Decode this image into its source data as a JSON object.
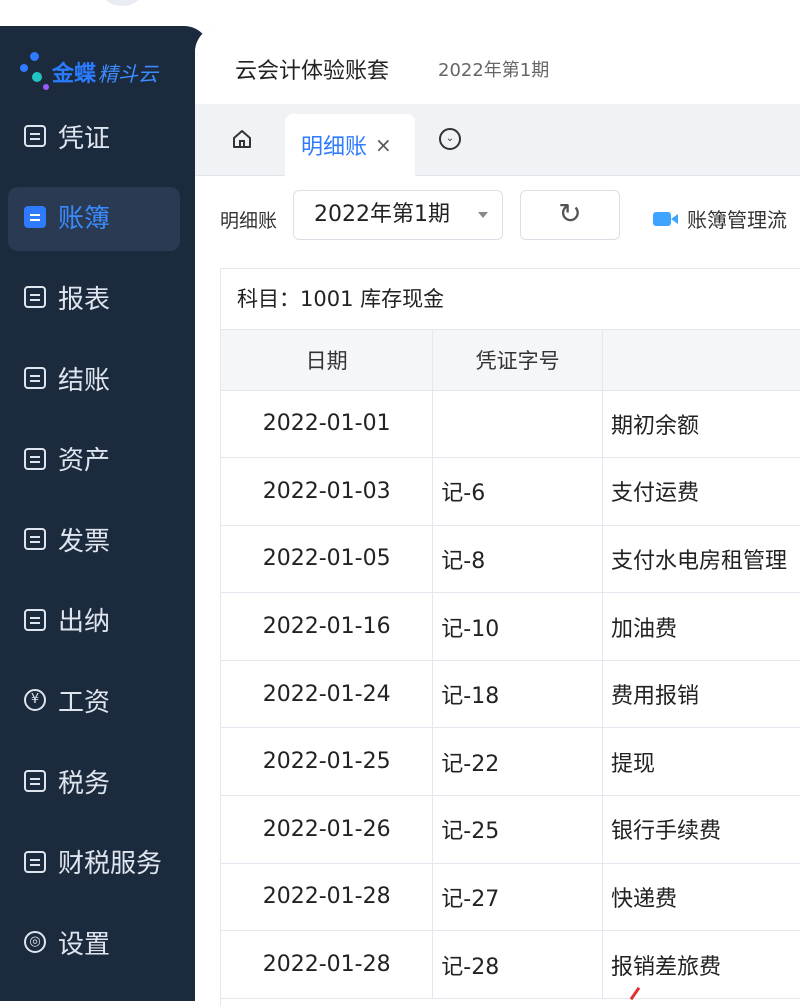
{
  "brand": {
    "name": "金蝶",
    "product": "精斗云"
  },
  "nav": {
    "items": [
      {
        "label": "凭证",
        "icon": "voucher-icon",
        "active": false
      },
      {
        "label": "账簿",
        "icon": "ledger-icon",
        "active": true
      },
      {
        "label": "报表",
        "icon": "report-icon",
        "active": false
      },
      {
        "label": "结账",
        "icon": "closing-icon",
        "active": false
      },
      {
        "label": "资产",
        "icon": "asset-icon",
        "active": false
      },
      {
        "label": "发票",
        "icon": "invoice-icon",
        "active": false
      },
      {
        "label": "出纳",
        "icon": "cashier-icon",
        "active": false
      },
      {
        "label": "工资",
        "icon": "salary-icon",
        "active": false
      },
      {
        "label": "税务",
        "icon": "tax-icon",
        "active": false
      },
      {
        "label": "财税服务",
        "icon": "service-icon",
        "active": false
      },
      {
        "label": "设置",
        "icon": "settings-icon",
        "active": false
      }
    ]
  },
  "header": {
    "title": "云会计体验账套",
    "period": "2022年第1期"
  },
  "tabs": {
    "items": [
      {
        "label": "明细账",
        "close": "×"
      }
    ]
  },
  "toolbar": {
    "label": "明细账",
    "period_select": "2022年第1期",
    "refresh": "↻",
    "manage_label": "账簿管理流"
  },
  "table": {
    "subject": "科目：1001 库存现金",
    "columns": [
      "日期",
      "凭证字号",
      ""
    ],
    "rows": [
      {
        "date": "2022-01-01",
        "voucher": "",
        "summary": "期初余额"
      },
      {
        "date": "2022-01-03",
        "voucher": "记-6",
        "summary": "支付运费"
      },
      {
        "date": "2022-01-05",
        "voucher": "记-8",
        "summary": "支付水电房租管理"
      },
      {
        "date": "2022-01-16",
        "voucher": "记-10",
        "summary": "加油费"
      },
      {
        "date": "2022-01-24",
        "voucher": "记-18",
        "summary": "费用报销"
      },
      {
        "date": "2022-01-25",
        "voucher": "记-22",
        "summary": "提现"
      },
      {
        "date": "2022-01-26",
        "voucher": "记-25",
        "summary": "银行手续费"
      },
      {
        "date": "2022-01-28",
        "voucher": "记-27",
        "summary": "快递费"
      },
      {
        "date": "2022-01-28",
        "voucher": "记-28",
        "summary": "报销差旅费"
      }
    ]
  },
  "colors": {
    "sidebar_bg": "#1c2a3d",
    "accent": "#2f7bff"
  }
}
